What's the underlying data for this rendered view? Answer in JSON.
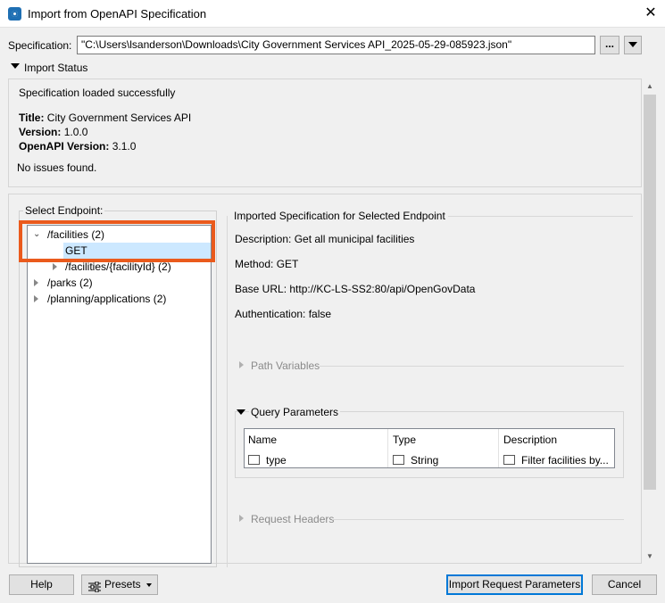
{
  "window": {
    "title": "Import from OpenAPI Specification",
    "close_glyph": "✕"
  },
  "spec": {
    "label": "Specification:",
    "value": "\"C:\\Users\\lsanderson\\Downloads\\City Government Services API_2025-05-29-085923.json\"",
    "browse_label": "..."
  },
  "status": {
    "header": "Import Status",
    "message": "Specification loaded successfully",
    "title_label": "Title:",
    "title_value": "City Government Services API",
    "version_label": "Version:",
    "version_value": "1.0.0",
    "openapi_label": "OpenAPI Version:",
    "openapi_value": "3.1.0",
    "issues": "No issues found."
  },
  "endpoints": {
    "legend": "Select Endpoint:",
    "items": [
      {
        "label": "/facilities (2)",
        "expanded": true
      },
      {
        "label": "GET",
        "selected": true
      },
      {
        "label": "/facilities/{facilityId} (2)"
      },
      {
        "label": "/parks (2)"
      },
      {
        "label": "/planning/applications (2)"
      }
    ]
  },
  "details": {
    "header": "Imported Specification for Selected Endpoint",
    "description": "Description: Get all municipal facilities",
    "method": "Method: GET",
    "base_url": "Base URL: http://KC-LS-SS2:80/api/OpenGovData",
    "auth": "Authentication: false",
    "path_variables": "Path Variables",
    "query_parameters": "Query Parameters",
    "request_headers": "Request Headers",
    "table": {
      "columns": [
        "Name",
        "Type",
        "Description"
      ],
      "rows": [
        {
          "name": "type",
          "type": "String",
          "description": "Filter facilities by..."
        }
      ]
    }
  },
  "footer": {
    "help": "Help",
    "presets": "Presets",
    "import": "Import Request Parameters",
    "cancel": "Cancel"
  },
  "colors": {
    "highlight": "#ea5a1c",
    "selection": "#cce8ff",
    "accent": "#0078d7"
  }
}
